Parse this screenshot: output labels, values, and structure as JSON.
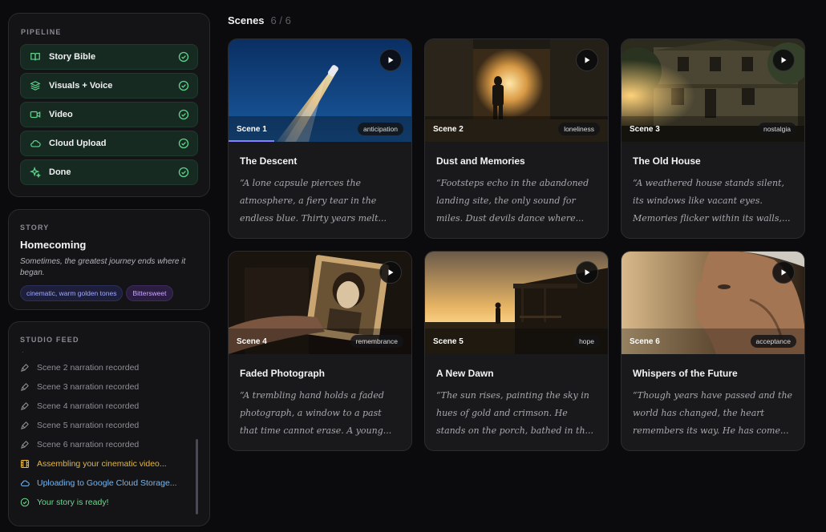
{
  "pipeline": {
    "title": "Pipeline",
    "steps": [
      {
        "label": "Story Bible",
        "icon": "book-icon"
      },
      {
        "label": "Visuals + Voice",
        "icon": "layers-icon"
      },
      {
        "label": "Video",
        "icon": "video-icon"
      },
      {
        "label": "Cloud Upload",
        "icon": "cloud-icon"
      },
      {
        "label": "Done",
        "icon": "sparkle-icon"
      }
    ]
  },
  "story": {
    "title": "Story",
    "name": "Homecoming",
    "logline": "Sometimes, the greatest journey ends where it began.",
    "tags": [
      "cinematic, warm golden tones",
      "Bittersweet"
    ]
  },
  "feed": {
    "title": "Studio Feed",
    "items": [
      {
        "text": "Scene 2 narration recorded",
        "kind": "gray",
        "icon": "mic-icon"
      },
      {
        "text": "Scene 3 narration recorded",
        "kind": "gray",
        "icon": "mic-icon"
      },
      {
        "text": "Scene 4 narration recorded",
        "kind": "gray",
        "icon": "mic-icon"
      },
      {
        "text": "Scene 5 narration recorded",
        "kind": "gray",
        "icon": "mic-icon"
      },
      {
        "text": "Scene 6 narration recorded",
        "kind": "gray",
        "icon": "mic-icon"
      },
      {
        "text": "Assembling your cinematic video...",
        "kind": "amber",
        "icon": "film-icon"
      },
      {
        "text": "Uploading to Google Cloud Storage...",
        "kind": "blue",
        "icon": "cloud-icon"
      },
      {
        "text": "Your story is ready!",
        "kind": "green",
        "icon": "check-circle-icon"
      }
    ]
  },
  "scenes_header": {
    "title": "Scenes",
    "count": "6 / 6"
  },
  "scenes": [
    {
      "label": "Scene 1",
      "mood": "anticipation",
      "title": "The Descent",
      "text": "“A lone capsule pierces the atmosphere, a fiery tear in the endless blue. Thirty years melt...",
      "playback_progress": 0.25
    },
    {
      "label": "Scene 2",
      "mood": "loneliness",
      "title": "Dust and Memories",
      "text": "“Footsteps echo in the abandoned landing site, the only sound for miles. Dust devils dance where..."
    },
    {
      "label": "Scene 3",
      "mood": "nostalgia",
      "title": "The Old House",
      "text": "“A weathered house stands silent, its windows like vacant eyes. Memories flicker within its walls,..."
    },
    {
      "label": "Scene 4",
      "mood": "remembrance",
      "title": "Faded Photograph",
      "text": "“A trembling hand holds a faded photograph, a window to a past that time cannot erase. A young..."
    },
    {
      "label": "Scene 5",
      "mood": "hope",
      "title": "A New Dawn",
      "text": "“The sun rises, painting the sky in hues of gold and crimson. He stands on the porch, bathed in th..."
    },
    {
      "label": "Scene 6",
      "mood": "acceptance",
      "title": "Whispers of the Future",
      "text": "“Though years have passed and the world has changed, the heart remembers its way. He has come..."
    }
  ]
}
